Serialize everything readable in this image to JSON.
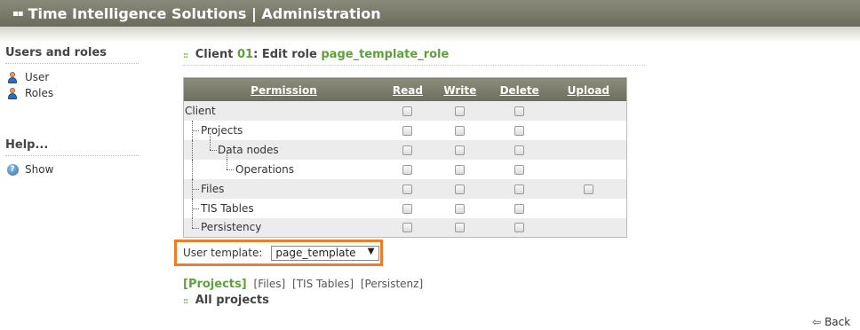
{
  "header": {
    "title": "Time Intelligence Solutions | Administration"
  },
  "sidebar": {
    "users_heading": "Users and roles",
    "items": [
      {
        "label": "User",
        "icon": "user-icon"
      },
      {
        "label": "Roles",
        "icon": "roles-icon"
      }
    ],
    "help_heading": "Help...",
    "help_items": [
      {
        "label": "Show",
        "icon": "help-icon"
      }
    ]
  },
  "main": {
    "title_prefix": "Client",
    "client_id": "01",
    "title_mid": ": Edit role",
    "role_name": "page_template_role"
  },
  "table": {
    "columns": [
      "Permission",
      "Read",
      "Write",
      "Delete",
      "Upload"
    ],
    "rows": [
      {
        "name": "Client",
        "level": 0,
        "read": true,
        "write": true,
        "delete": true,
        "upload": false
      },
      {
        "name": "Projects",
        "level": 1,
        "read": true,
        "write": true,
        "delete": true,
        "upload": false
      },
      {
        "name": "Data nodes",
        "level": 2,
        "read": true,
        "write": true,
        "delete": true,
        "upload": false
      },
      {
        "name": "Operations",
        "level": 3,
        "read": true,
        "write": true,
        "delete": true,
        "upload": false
      },
      {
        "name": "Files",
        "level": 1,
        "read": true,
        "write": true,
        "delete": true,
        "upload": true
      },
      {
        "name": "TIS Tables",
        "level": 1,
        "read": true,
        "write": true,
        "delete": true,
        "upload": false
      },
      {
        "name": "Persistency",
        "level": 1,
        "read": true,
        "write": true,
        "delete": true,
        "upload": false
      }
    ]
  },
  "template": {
    "label": "User template:",
    "value": "page_template"
  },
  "tabs": {
    "active": "[Projects]",
    "others": [
      "[Files]",
      "[TIS Tables]",
      "[Persistenz]"
    ]
  },
  "section": {
    "title": "All projects"
  },
  "back": {
    "label": "Back"
  },
  "colors": {
    "accent_green": "#5ea13a",
    "highlight_orange": "#f07c28",
    "header_bg": "#6b6b5b"
  }
}
